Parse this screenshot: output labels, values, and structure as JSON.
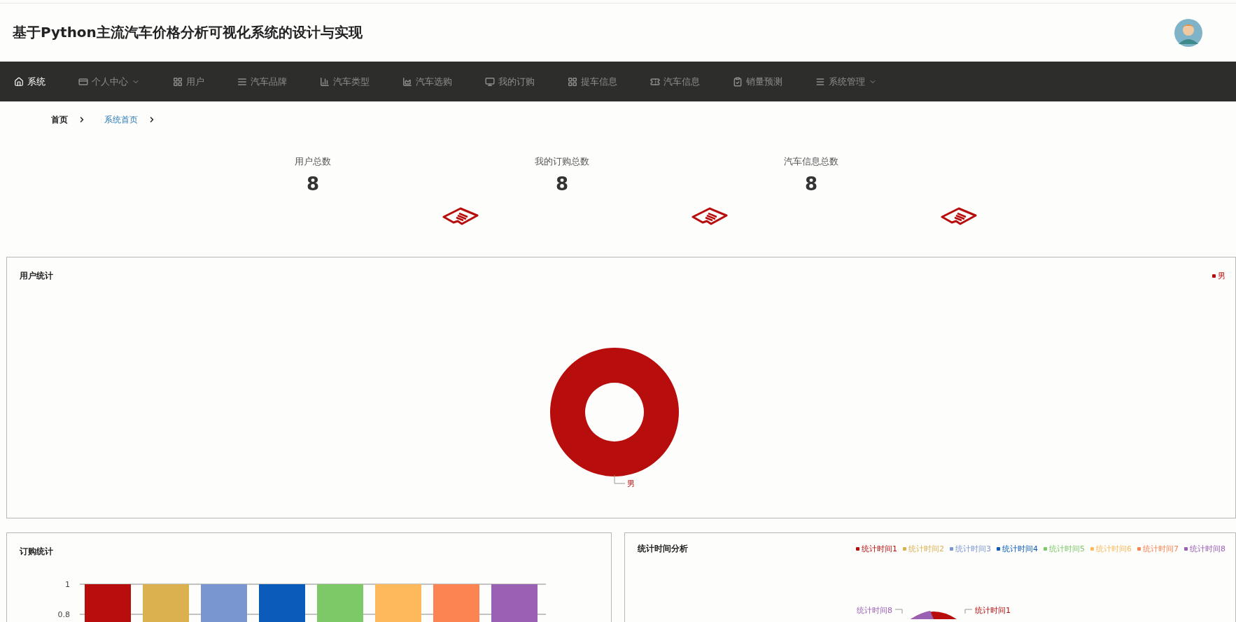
{
  "header": {
    "title": "基于Python主流汽车价格分析可视化系统的设计与实现"
  },
  "nav": [
    {
      "label": "系统",
      "selected": true,
      "has_dropdown": false
    },
    {
      "label": "个人中心",
      "selected": false,
      "has_dropdown": true
    },
    {
      "label": "用户",
      "selected": false,
      "has_dropdown": false
    },
    {
      "label": "汽车品牌",
      "selected": false,
      "has_dropdown": false
    },
    {
      "label": "汽车类型",
      "selected": false,
      "has_dropdown": false
    },
    {
      "label": "汽车选购",
      "selected": false,
      "has_dropdown": false
    },
    {
      "label": "我的订购",
      "selected": false,
      "has_dropdown": false
    },
    {
      "label": "提车信息",
      "selected": false,
      "has_dropdown": false
    },
    {
      "label": "汽车信息",
      "selected": false,
      "has_dropdown": false
    },
    {
      "label": "销量预测",
      "selected": false,
      "has_dropdown": false
    },
    {
      "label": "系统管理",
      "selected": false,
      "has_dropdown": true
    }
  ],
  "breadcrumb": [
    {
      "label": "首页",
      "selected": false
    },
    {
      "label": "系统首页",
      "selected": true
    }
  ],
  "stats": [
    {
      "label": "用户总数",
      "value": "8"
    },
    {
      "label": "我的订购总数",
      "value": "8"
    },
    {
      "label": "汽车信息总数",
      "value": "8"
    }
  ],
  "user_panel": {
    "title": "用户统计",
    "legend": [
      {
        "label": "男",
        "color": "#b80d0d"
      }
    ],
    "slice_label": "男"
  },
  "order_panel": {
    "title": "订购统计",
    "chart_data": {
      "type": "bar",
      "values": [
        1,
        1,
        1,
        1,
        1,
        1,
        1,
        1
      ],
      "colors": [
        "#b80d0d",
        "#dbb04f",
        "#7a96d1",
        "#0a5bba",
        "#7dc967",
        "#fdb95c",
        "#fc8452",
        "#9a60b4"
      ],
      "yticks": [
        0.8,
        1
      ],
      "ylim": [
        0.75,
        1
      ]
    }
  },
  "time_panel": {
    "title": "统计时间分析",
    "legend": [
      {
        "label": "统计时间1",
        "color": "#b80d0d"
      },
      {
        "label": "统计时间2",
        "color": "#dbb04f"
      },
      {
        "label": "统计时间3",
        "color": "#7a96d1"
      },
      {
        "label": "统计时间4",
        "color": "#0a5bba"
      },
      {
        "label": "统计时间5",
        "color": "#7dc967"
      },
      {
        "label": "统计时间6",
        "color": "#fdb95c"
      },
      {
        "label": "统计时间7",
        "color": "#fc8452"
      },
      {
        "label": "统计时间8",
        "color": "#9a60b4"
      }
    ],
    "slice_labels": [
      {
        "label": "统计时间8",
        "color": "#9a60b4"
      },
      {
        "label": "统计时间1",
        "color": "#b80d0d"
      }
    ]
  }
}
